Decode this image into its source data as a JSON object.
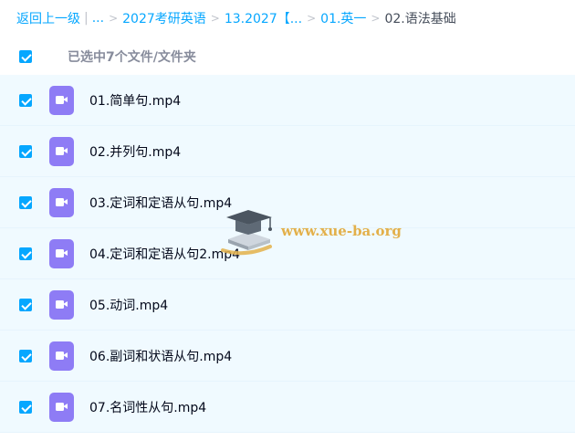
{
  "breadcrumb": {
    "back": "返回上一级",
    "bar": "|",
    "ellipsis": "...",
    "sep": ">",
    "items": [
      "2027考研英语",
      "13.2027【...",
      "01.英一"
    ],
    "current": "02.语法基础"
  },
  "selection": {
    "text": "已选中7个文件/文件夹",
    "checked": true
  },
  "files": [
    {
      "name": "01.简单句.mp4",
      "checked": true,
      "icon": "video-file-icon"
    },
    {
      "name": "02.并列句.mp4",
      "checked": true,
      "icon": "video-file-icon"
    },
    {
      "name": "03.定词和定语从句.mp4",
      "checked": true,
      "icon": "video-file-icon"
    },
    {
      "name": "04.定词和定语从句2.mp4",
      "checked": true,
      "icon": "video-file-icon"
    },
    {
      "name": "05.动词.mp4",
      "checked": true,
      "icon": "video-file-icon"
    },
    {
      "name": "06.副词和状语从句.mp4",
      "checked": true,
      "icon": "video-file-icon"
    },
    {
      "name": "07.名词性从句.mp4",
      "checked": true,
      "icon": "video-file-icon"
    }
  ],
  "watermark": {
    "text": "www.xue-ba.org"
  },
  "colors": {
    "accent": "#06a7ff",
    "row_bg": "#f0faff",
    "video_icon": "#8e7cf5",
    "watermark": "#e3b04a"
  }
}
